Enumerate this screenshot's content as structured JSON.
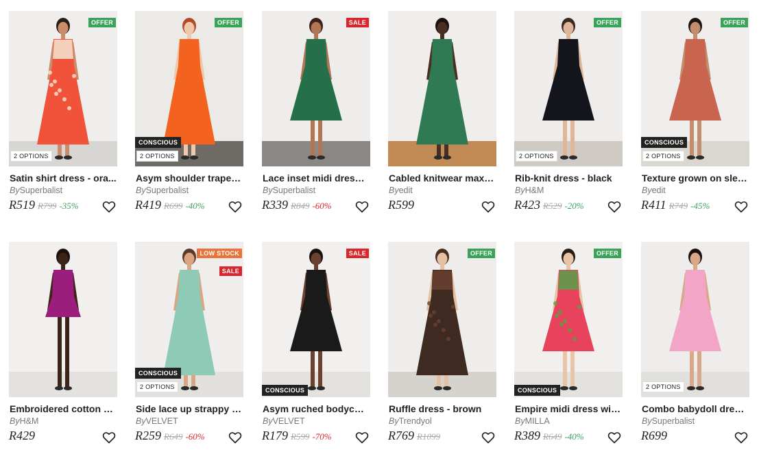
{
  "currency_note": "",
  "colors": {
    "offer": "#3aa35a",
    "sale": "#d9262c",
    "low_stock": "#e8743b",
    "conscious": "#222222",
    "discount_green": "#3aa35a",
    "discount_red": "#d9262c"
  },
  "products": [
    {
      "name": "Satin shirt dress - ora...",
      "by": "By",
      "brand": "Superbalist",
      "price": "R519",
      "was": "R799",
      "discount": "-35%",
      "discount_color": "green",
      "badges": [
        "OFFER"
      ],
      "conscious": "",
      "options": "2 OPTIONS",
      "favourite_icon": "heart-outline-icon"
    },
    {
      "name": "Asym shoulder trapez...",
      "by": "By",
      "brand": "Superbalist",
      "price": "R419",
      "was": "R699",
      "discount": "-40%",
      "discount_color": "green",
      "badges": [
        "OFFER"
      ],
      "conscious": "CONSCIOUS",
      "options": "2 OPTIONS",
      "favourite_icon": "heart-outline-icon"
    },
    {
      "name": "Lace inset midi dress ...",
      "by": "By",
      "brand": "Superbalist",
      "price": "R339",
      "was": "R849",
      "discount": "-60%",
      "discount_color": "red",
      "badges": [
        "SALE"
      ],
      "conscious": "",
      "options": "",
      "favourite_icon": "heart-outline-icon"
    },
    {
      "name": "Cabled knitwear maxi ...",
      "by": "By",
      "brand": "edit",
      "price": "R599",
      "was": "",
      "discount": "",
      "discount_color": "",
      "badges": [],
      "conscious": "",
      "options": "",
      "favourite_icon": "heart-outline-icon"
    },
    {
      "name": "Rib-knit dress - black",
      "by": "By",
      "brand": "H&M",
      "price": "R423",
      "was": "R529",
      "discount": "-20%",
      "discount_color": "green",
      "badges": [
        "OFFER"
      ],
      "conscious": "",
      "options": "2 OPTIONS",
      "favourite_icon": "heart-outline-icon"
    },
    {
      "name": "Texture grown on slee...",
      "by": "By",
      "brand": "edit",
      "price": "R411",
      "was": "R749",
      "discount": "-45%",
      "discount_color": "green",
      "badges": [
        "OFFER"
      ],
      "conscious": "CONSCIOUS",
      "options": "2 OPTIONS",
      "favourite_icon": "heart-outline-icon"
    },
    {
      "name": "Embroidered cotton d...",
      "by": "By",
      "brand": "H&M",
      "price": "R429",
      "was": "",
      "discount": "",
      "discount_color": "",
      "badges": [],
      "conscious": "",
      "options": "",
      "favourite_icon": "heart-outline-icon"
    },
    {
      "name": "Side lace up strappy sl...",
      "by": "By",
      "brand": "VELVET",
      "price": "R259",
      "was": "R649",
      "discount": "-60%",
      "discount_color": "red",
      "badges": [
        "LOW STOCK",
        "SALE"
      ],
      "conscious": "CONSCIOUS",
      "options": "2 OPTIONS",
      "favourite_icon": "heart-outline-icon"
    },
    {
      "name": "Asym ruched bodycon...",
      "by": "By",
      "brand": "VELVET",
      "price": "R179",
      "was": "R599",
      "discount": "-70%",
      "discount_color": "red",
      "badges": [
        "SALE"
      ],
      "conscious": "CONSCIOUS",
      "options": "",
      "favourite_icon": "heart-outline-icon"
    },
    {
      "name": "Ruffle dress - brown",
      "by": "By",
      "brand": "Trendyol",
      "price": "R769",
      "was": "R1099",
      "discount": "",
      "discount_color": "",
      "badges": [
        "OFFER"
      ],
      "conscious": "",
      "options": "",
      "favourite_icon": "heart-outline-icon"
    },
    {
      "name": "Empire midi dress wit...",
      "by": "By",
      "brand": "MILLA",
      "price": "R389",
      "was": "R649",
      "discount": "-40%",
      "discount_color": "green",
      "badges": [
        "OFFER"
      ],
      "conscious": "CONSCIOUS",
      "options": "",
      "favourite_icon": "heart-outline-icon"
    },
    {
      "name": "Combo babydoll dress...",
      "by": "By",
      "brand": "Superbalist",
      "price": "R699",
      "was": "",
      "discount": "",
      "discount_color": "",
      "badges": [],
      "conscious": "",
      "options": "2 OPTIONS",
      "favourite_icon": "heart-outline-icon"
    }
  ],
  "images": [
    {
      "bg": "#efeeec",
      "floor": "#d8d6d2",
      "dress": "#f0533a",
      "dress2": "#f3e6d2",
      "skin": "#c98d6b",
      "hair": "#2a1d16",
      "shape": "maxi"
    },
    {
      "bg": "#eceae6",
      "floor": "#6e6a66",
      "dress": "#f3621e",
      "dress2": "#f3621e",
      "skin": "#f0c9ad",
      "hair": "#b44a2a",
      "shape": "maxi"
    },
    {
      "bg": "#eeedeb",
      "floor": "#8a8784",
      "dress": "#25704a",
      "dress2": "#25704a",
      "skin": "#b27657",
      "hair": "#3b2218",
      "shape": "midi"
    },
    {
      "bg": "#efeeec",
      "floor": "#c28b55",
      "dress": "#2f7a52",
      "dress2": "#2f7a52",
      "skin": "#4a2e22",
      "hair": "#1b1210",
      "shape": "maxi"
    },
    {
      "bg": "#eeedeb",
      "floor": "#cfcac4",
      "dress": "#14141c",
      "dress2": "#14141c",
      "skin": "#e0b69a",
      "hair": "#3a2a20",
      "shape": "midi"
    },
    {
      "bg": "#efeeec",
      "floor": "#dad6d0",
      "dress": "#c9654e",
      "dress2": "#c9654e",
      "skin": "#c48d6e",
      "hair": "#1e1410",
      "shape": "midi"
    },
    {
      "bg": "#f1f0ee",
      "floor": "#e4e2de",
      "dress": "#9b1d7c",
      "dress2": "#9b1d7c",
      "skin": "#3d2419",
      "hair": "#1a100c",
      "shape": "mini"
    },
    {
      "bg": "#efeeec",
      "floor": "#e2e0dc",
      "dress": "#8fcab6",
      "dress2": "#8fcab6",
      "skin": "#d9a582",
      "hair": "#5a3a24",
      "shape": "maxi"
    },
    {
      "bg": "#f1f0ee",
      "floor": "#e4e2de",
      "dress": "#1a1a1a",
      "dress2": "#1a1a1a",
      "skin": "#6b4230",
      "hair": "#1a100c",
      "shape": "midi"
    },
    {
      "bg": "#eeedeb",
      "floor": "#d6d3cf",
      "dress": "#3e2a20",
      "dress2": "#6a4232",
      "skin": "#e6c0a3",
      "hair": "#4a2f20",
      "shape": "maxi"
    },
    {
      "bg": "#f1f0ee",
      "floor": "#e4e2de",
      "dress": "#e8435c",
      "dress2": "#56a048",
      "skin": "#e8c4a8",
      "hair": "#2a1c14",
      "shape": "midi"
    },
    {
      "bg": "#eeedeb",
      "floor": "#e2e0dc",
      "dress": "#f3a5c8",
      "dress2": "#f3a5c8",
      "skin": "#d8a888",
      "hair": "#1a100c",
      "shape": "midi"
    }
  ]
}
